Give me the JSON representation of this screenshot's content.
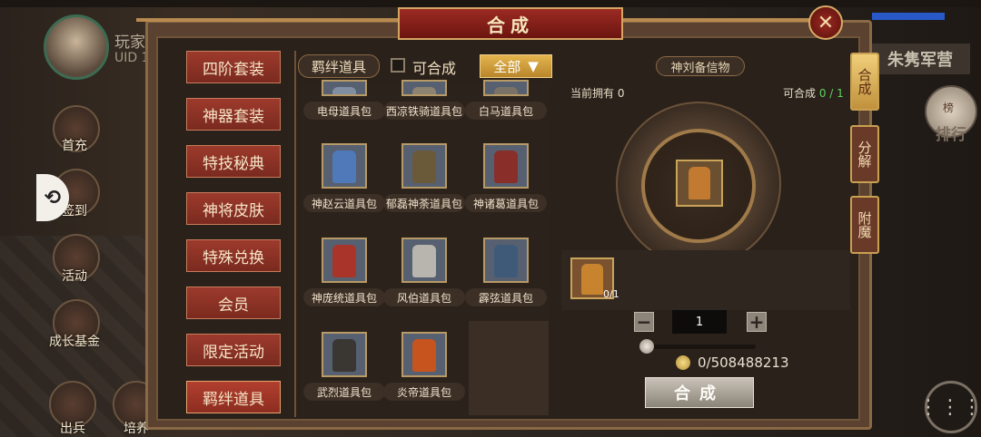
{
  "window": {
    "title": "合成",
    "close_symbol": "✕"
  },
  "hud": {
    "player_name": "玩家",
    "player_uid": "UID 1",
    "left_buttons": [
      "首充",
      "签到",
      "活动",
      "成长基金",
      "出兵",
      "培养"
    ],
    "right_title": "朱隽军营",
    "rank_label": "排行",
    "rank_badge_text": "榜",
    "menu_symbol": "⋮⋮⋮"
  },
  "categories": [
    {
      "label": "四阶套装",
      "active": false
    },
    {
      "label": "神器套装",
      "active": false
    },
    {
      "label": "特技秘典",
      "active": false
    },
    {
      "label": "神将皮肤",
      "active": false
    },
    {
      "label": "特殊兑换",
      "active": false
    },
    {
      "label": "会员",
      "active": false
    },
    {
      "label": "限定活动",
      "active": false
    },
    {
      "label": "羁绊道具",
      "active": true
    }
  ],
  "filter": {
    "current_category": "羁绊道具",
    "craftable_label": "可合成",
    "craftable_checked": false,
    "dropdown_value": "全部",
    "dropdown_arrow": "▼"
  },
  "items": [
    {
      "name": "电母道具包",
      "partial": true,
      "color": "#7f8ea0"
    },
    {
      "name": "西凉铁骑道具包",
      "partial": true,
      "color": "#8c8470"
    },
    {
      "name": "白马道具包",
      "partial": true,
      "color": "#7a7266"
    },
    {
      "name": "神赵云道具包",
      "partial": false,
      "color": "#4f79b8"
    },
    {
      "name": "郁磊神荼道具包",
      "partial": false,
      "color": "#6b5a3a"
    },
    {
      "name": "神诸葛道具包",
      "partial": false,
      "color": "#8a2e2a"
    },
    {
      "name": "神庞统道具包",
      "partial": false,
      "color": "#a9342a"
    },
    {
      "name": "风伯道具包",
      "partial": false,
      "color": "#b8b4ae"
    },
    {
      "name": "霹弦道具包",
      "partial": false,
      "color": "#3e5a78"
    },
    {
      "name": "武烈道具包",
      "partial": false,
      "color": "#3a3632"
    },
    {
      "name": "炎帝道具包",
      "partial": false,
      "color": "#c7541e"
    }
  ],
  "craft": {
    "target_name": "神刘备信物",
    "owned_label": "当前拥有",
    "owned_value": "0",
    "craftable_label": "可合成",
    "craftable_value": "0 / 1",
    "material_qty": "0/1",
    "quantity": "1",
    "minus": "−",
    "plus": "+",
    "cost": "0/508488213",
    "button_label": "合成"
  },
  "side_tabs": [
    {
      "label": "合成",
      "active": true
    },
    {
      "label": "分解",
      "active": false
    },
    {
      "label": "附魔",
      "active": false
    }
  ]
}
